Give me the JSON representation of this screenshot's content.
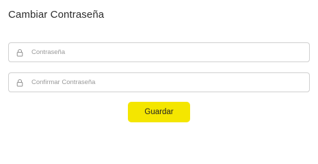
{
  "form": {
    "title": "Cambiar Contraseña",
    "password": {
      "icon": "lock-icon",
      "placeholder": "Contraseña",
      "value": ""
    },
    "confirm_password": {
      "icon": "lock-icon",
      "placeholder": "Confirmar Contraseña",
      "value": ""
    },
    "save_label": "Guardar"
  },
  "colors": {
    "accent": "#f4e600",
    "border": "#cfcfcf",
    "placeholder": "#9a9a9a",
    "title": "#2b2b2b"
  }
}
